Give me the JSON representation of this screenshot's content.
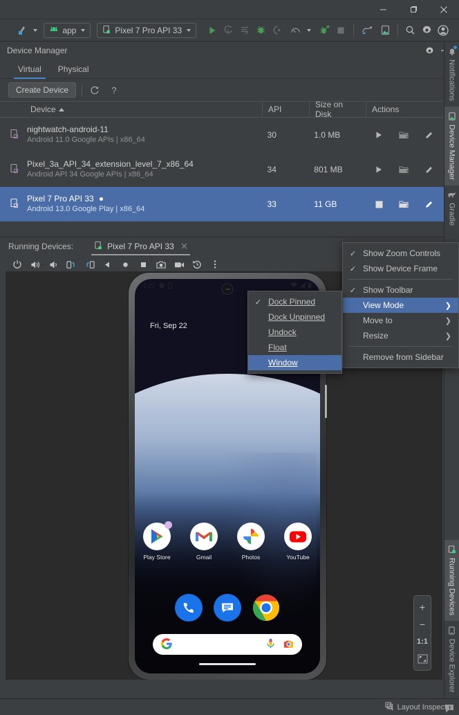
{
  "window": {
    "minimize_label": "Minimize",
    "restore_label": "Restore",
    "close_label": "Close"
  },
  "toolbar": {
    "project_icon": "android-studio-logo-icon",
    "run_config": {
      "label": "app",
      "icon": "android-head-icon"
    },
    "device_target": {
      "label": "Pixel 7 Pro API 33",
      "icon": "device-phone-icon"
    },
    "buttons": [
      {
        "name": "run-button",
        "icon": "play-icon",
        "enabled": true
      },
      {
        "name": "apply-changes-button",
        "icon": "apply-changes-icon",
        "enabled": false
      },
      {
        "name": "apply-code-changes-button",
        "icon": "apply-code-changes-icon",
        "enabled": false
      },
      {
        "name": "debug-button",
        "icon": "bug-icon",
        "enabled": true
      },
      {
        "name": "attach-debugger-button",
        "icon": "attach-debugger-icon",
        "enabled": false
      },
      {
        "name": "profiler-button",
        "icon": "profiler-icon",
        "enabled": false
      },
      {
        "name": "run-with-coverage-button",
        "icon": "coverage-icon",
        "enabled": true
      },
      {
        "name": "stop-button",
        "icon": "stop-square-icon",
        "enabled": false
      },
      {
        "name": "sdk-manager-button",
        "icon": "sdk-manager-icon",
        "enabled": true
      },
      {
        "name": "device-manager-button",
        "icon": "device-manager-icon",
        "enabled": true
      },
      {
        "name": "search-everywhere-button",
        "icon": "magnifier-icon",
        "enabled": true
      },
      {
        "name": "settings-button",
        "icon": "gear-icon",
        "enabled": true
      },
      {
        "name": "account-button",
        "icon": "user-avatar-icon",
        "enabled": true
      }
    ]
  },
  "device_manager": {
    "title": "Device Manager",
    "settings_icon": "gear-icon",
    "minimize_icon": "minimize-icon",
    "tabs": [
      {
        "label": "Virtual",
        "active": true
      },
      {
        "label": "Physical",
        "active": false
      }
    ],
    "create_device_label": "Create Device",
    "refresh_icon": "refresh-icon",
    "help_icon": "help-question-icon",
    "columns": [
      "Device",
      "API",
      "Size on Disk",
      "Actions"
    ],
    "sort_column": "Device",
    "sort_direction": "ascending",
    "rows": [
      {
        "name": "nightwatch-android-11",
        "detail": "Android 11.0 Google APIs | x86_64",
        "api": "30",
        "size": "1.0 MB",
        "running": false,
        "selected": false,
        "actions": [
          "play-icon",
          "folder-icon",
          "pencil-edit-icon",
          "overflow-menu-icon"
        ]
      },
      {
        "name": "Pixel_3a_API_34_extension_level_7_x86_64",
        "detail": "Android API 34 Google APIs | x86_64",
        "api": "34",
        "size": "801 MB",
        "running": false,
        "selected": false,
        "actions": [
          "play-icon",
          "folder-icon",
          "pencil-edit-icon",
          "overflow-menu-icon"
        ]
      },
      {
        "name": "Pixel 7 Pro API 33",
        "detail": "Android 13.0 Google Play | x86_64",
        "api": "33",
        "size": "11 GB",
        "running": true,
        "selected": true,
        "actions": [
          "stop-square-icon",
          "folder-icon",
          "pencil-edit-icon",
          "overflow-menu-icon"
        ]
      }
    ]
  },
  "running_devices": {
    "label": "Running Devices:",
    "tab": {
      "label": "Pixel 7 Pro API 33",
      "icon": "device-phone-icon",
      "close_icon": "close-x-icon"
    },
    "emulator_toolbar": [
      {
        "name": "power-button",
        "icon": "power-icon"
      },
      {
        "name": "volume-up-button",
        "icon": "volume-up-icon"
      },
      {
        "name": "volume-down-button",
        "icon": "volume-down-icon"
      },
      {
        "name": "rotate-left-button",
        "icon": "rotate-left-icon"
      },
      {
        "name": "rotate-right-button",
        "icon": "rotate-right-icon"
      },
      {
        "name": "back-button",
        "icon": "triangle-back-icon"
      },
      {
        "name": "home-button",
        "icon": "circle-home-icon"
      },
      {
        "name": "overview-button",
        "icon": "square-overview-icon"
      },
      {
        "name": "screenshot-button",
        "icon": "camera-icon"
      },
      {
        "name": "record-screen-button",
        "icon": "video-camera-icon"
      },
      {
        "name": "restore-button",
        "icon": "history-restore-icon"
      },
      {
        "name": "more-options-button",
        "icon": "overflow-menu-icon"
      }
    ],
    "zoom_controls": [
      {
        "name": "zoom-in-button",
        "label": "+"
      },
      {
        "name": "zoom-out-button",
        "label": "−"
      },
      {
        "name": "zoom-actual-button",
        "label": "1:1"
      },
      {
        "name": "zoom-fit-button",
        "label": ""
      }
    ]
  },
  "emulator_screen": {
    "status_bar": {
      "time": "1:22",
      "left_icons": [
        "shield-icon",
        "battery-saver-icon"
      ],
      "right_icons": [
        "wifi-icon",
        "signal-icon",
        "battery-icon"
      ]
    },
    "date_widget": "Fri, Sep 22",
    "apps": [
      {
        "label": "Play Store",
        "icon": "play-store-icon"
      },
      {
        "label": "Gmail",
        "icon": "gmail-icon"
      },
      {
        "label": "Photos",
        "icon": "google-photos-icon"
      },
      {
        "label": "YouTube",
        "icon": "youtube-icon"
      }
    ],
    "dock": [
      {
        "label": "Phone",
        "icon": "phone-dialer-icon"
      },
      {
        "label": "Messages",
        "icon": "messages-icon"
      },
      {
        "label": "Chrome",
        "icon": "chrome-icon"
      }
    ],
    "search_bar": {
      "logo_icon": "google-g-icon",
      "mic_icon": "microphone-icon",
      "lens_icon": "google-lens-icon"
    }
  },
  "context_menu_view_mode": {
    "items": [
      {
        "label": "Show Zoom Controls",
        "checked": true,
        "submenu": false,
        "selected": false
      },
      {
        "label": "Show Device Frame",
        "checked": true,
        "submenu": false,
        "selected": false
      },
      {
        "separator": true
      },
      {
        "label": "Show Toolbar",
        "checked": true,
        "submenu": false,
        "selected": false
      },
      {
        "label": "View Mode",
        "checked": false,
        "submenu": true,
        "selected": true
      },
      {
        "label": "Move to",
        "checked": false,
        "submenu": true,
        "selected": false
      },
      {
        "label": "Resize",
        "checked": false,
        "submenu": true,
        "selected": false
      },
      {
        "separator": true
      },
      {
        "label": "Remove from Sidebar",
        "checked": false,
        "submenu": false,
        "selected": false
      }
    ]
  },
  "context_menu_dock": {
    "items": [
      {
        "label": "Dock Pinned",
        "mnemonic": "P",
        "checked": true,
        "selected": false
      },
      {
        "label": "Dock Unpinned",
        "mnemonic": "U",
        "checked": false,
        "selected": false
      },
      {
        "label": "Undock",
        "mnemonic": "d",
        "checked": false,
        "selected": false
      },
      {
        "label": "Float",
        "mnemonic": "F",
        "checked": false,
        "selected": false
      },
      {
        "label": "Window",
        "mnemonic": "W",
        "checked": false,
        "selected": true
      }
    ]
  },
  "right_sidebar": {
    "top": [
      {
        "label": "Notifications",
        "icon": "notification-bell-icon",
        "active": false,
        "badge": true
      },
      {
        "label": "Device Manager",
        "icon": "device-manager-icon",
        "active": true,
        "badge": false
      },
      {
        "label": "Gradle",
        "icon": "gradle-elephant-icon",
        "active": false,
        "badge": false
      }
    ],
    "bottom": [
      {
        "label": "Running Devices",
        "icon": "running-device-icon",
        "active": true,
        "badge": false
      },
      {
        "label": "Device Explorer",
        "icon": "device-explorer-icon",
        "active": false,
        "badge": false
      }
    ]
  },
  "status_bar": {
    "layout_inspector": {
      "label": "Layout Inspector",
      "icon": "layout-inspector-icon"
    },
    "notification_icon": "warning-notification-icon"
  },
  "colors": {
    "background": "#3c3f41",
    "panel": "#3c3f41",
    "selection": "#4a6da7",
    "accent_blue": "#4a88c7",
    "green": "#499c54",
    "text": "#bbbbbb",
    "text_dim": "#919191"
  }
}
